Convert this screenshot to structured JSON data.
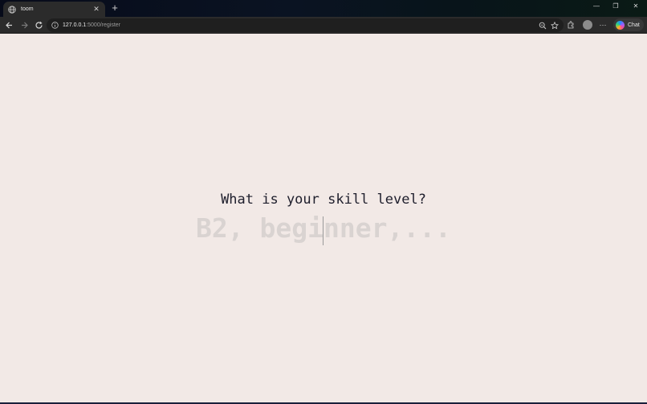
{
  "browser": {
    "tab": {
      "title": "toom",
      "favicon": "globe-icon",
      "close_glyph": "✕"
    },
    "new_tab_glyph": "+",
    "window_controls": {
      "minimize": "—",
      "restore": "❐",
      "close": "✕"
    },
    "address_bar": {
      "host": "127.0.0.1",
      "path": ":5000/register",
      "info_icon": "info-icon"
    },
    "toolbar_icons": [
      "back-icon",
      "forward-icon",
      "reload-icon",
      "zoom-icon",
      "star-icon",
      "extensions-icon",
      "profile-avatar",
      "more-icon"
    ],
    "more_label": "⋯",
    "chat_button": {
      "label": "Chat"
    }
  },
  "page": {
    "background": "#f2e9e6",
    "question": "What is your skill level?",
    "answer": {
      "value": "",
      "placeholder": "B2, beginner,..."
    }
  }
}
